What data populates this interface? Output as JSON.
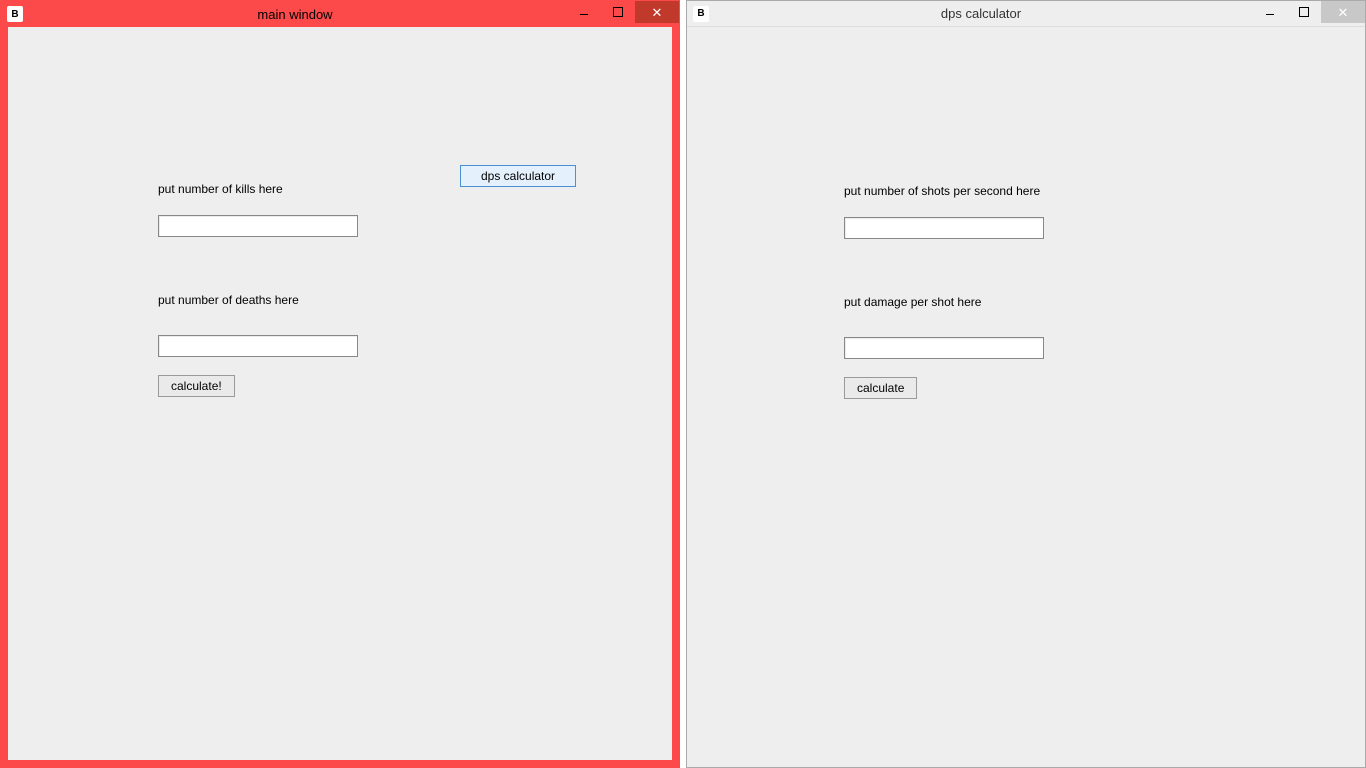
{
  "windows": {
    "main": {
      "title": "main window",
      "kills_label": "put number of kills here",
      "deaths_label": "put number of deaths here",
      "calculate_label": "calculate!",
      "dps_button_label": "dps calculator",
      "kills_value": "",
      "deaths_value": ""
    },
    "dps": {
      "title": "dps calculator",
      "shots_label": "put number of shots per second here",
      "damage_label": "put damage per shot here",
      "calculate_label": "calculate",
      "shots_value": "",
      "damage_value": ""
    }
  },
  "icons": {
    "app_letter": "B",
    "close_glyph": "✕"
  }
}
